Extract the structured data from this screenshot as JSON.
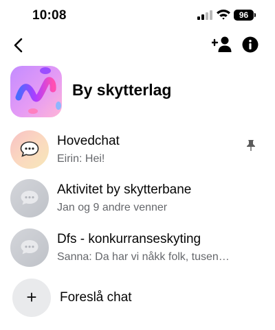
{
  "status_bar": {
    "time": "10:08",
    "battery": "96"
  },
  "group": {
    "title": "By skytterlag"
  },
  "chats": [
    {
      "name": "Hovedchat",
      "subtitle": "Eirin: Hei!",
      "pinned": true,
      "avatar_style": "warm-gradient"
    },
    {
      "name": "Aktivitet by skytterbane",
      "subtitle": "Jan og 9 andre venner",
      "pinned": false,
      "avatar_style": "gray"
    },
    {
      "name": "Dfs - konkurranseskyting",
      "subtitle": "Sanna: Da har vi nåkk folk, tusen…",
      "pinned": false,
      "avatar_style": "gray"
    }
  ],
  "suggest": {
    "label": "Foreslå chat",
    "icon": "+"
  },
  "icons": [
    "back-chevron",
    "add-person",
    "info",
    "pin",
    "chat-bubble",
    "signal",
    "wifi",
    "battery"
  ],
  "colors": {
    "text": "#050505",
    "secondary_text": "#65676b",
    "gray_avatar": "#c9ccd1",
    "plus_circle": "#e9eaec"
  }
}
